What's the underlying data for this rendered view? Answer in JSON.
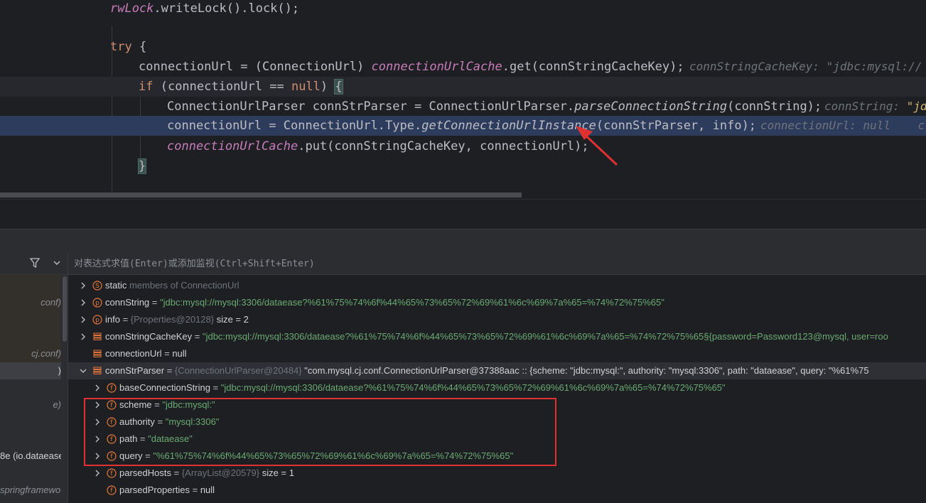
{
  "editor": {
    "lines": [
      {
        "id": "l1",
        "tokens": [
          {
            "t": "rwLock",
            "c": "fld"
          },
          {
            "t": ".writeLock().lock();",
            "c": ""
          }
        ]
      },
      {
        "id": "l2",
        "tokens": []
      },
      {
        "id": "l3",
        "tokens": [
          {
            "t": "try",
            "c": "kw"
          },
          {
            "t": " {",
            "c": ""
          }
        ]
      },
      {
        "id": "l4",
        "tokens": [
          {
            "t": "connectionUrl = (ConnectionUrl) ",
            "c": ""
          },
          {
            "t": "connectionUrlCache",
            "c": "fld"
          },
          {
            "t": ".get(connStringCacheKey);",
            "c": ""
          }
        ],
        "hint": "connStringCacheKey: \"jdbc:mysql://"
      },
      {
        "id": "l5",
        "tokens": [
          {
            "t": "if",
            "c": "kw"
          },
          {
            "t": " (connectionUrl == ",
            "c": ""
          },
          {
            "t": "null",
            "c": "kw"
          },
          {
            "t": ") ",
            "c": ""
          },
          {
            "t": "{",
            "c": "brace"
          }
        ]
      },
      {
        "id": "l6",
        "tokens": [
          {
            "t": "ConnectionUrlParser connStrParser = ConnectionUrlParser.",
            "c": ""
          },
          {
            "t": "parseConnectionString",
            "c": "mth"
          },
          {
            "t": "(connString);",
            "c": ""
          }
        ],
        "hint": "connString: ",
        "hintval": "\"jd"
      },
      {
        "id": "l7",
        "tokens": [
          {
            "t": "connectionUrl = ConnectionUrl.Type.",
            "c": ""
          },
          {
            "t": "getConnectionUrlInstance",
            "c": "mth"
          },
          {
            "t": "(connStrParser, info);",
            "c": ""
          }
        ],
        "hint": "connectionUrl: null    c"
      },
      {
        "id": "l8",
        "tokens": [
          {
            "t": "connectionUrlCache",
            "c": "fld"
          },
          {
            "t": ".put(connStringCacheKey, connectionUrl);",
            "c": ""
          }
        ]
      },
      {
        "id": "l9",
        "tokens": [
          {
            "t": "}",
            "c": "brace"
          }
        ]
      }
    ]
  },
  "frames": {
    "items": [
      "conf)",
      "cj.conf)",
      ")",
      "e)",
      "8e (io.dataease",
      "springframewo"
    ]
  },
  "evaluate": {
    "placeholder": "对表达式求值(Enter)或添加监视(Ctrl+Shift+Enter)"
  },
  "variables": [
    {
      "icon": "S",
      "name": "static",
      "rest": " members of ConnectionUrl",
      "kind": "static"
    },
    {
      "icon": "p",
      "name": "connString",
      "value": "\"jdbc:mysql://mysql:3306/dataease?%61%75%74%6f%44%65%73%65%72%69%61%6c%69%7a%65=%74%72%75%65\""
    },
    {
      "icon": "p",
      "name": "info",
      "ref": "{Properties@20128}",
      "extra": "size = 2"
    },
    {
      "icon": "var",
      "name": "connStringCacheKey",
      "value": "\"jdbc:mysql://mysql:3306/dataease?%61%75%74%6f%44%65%73%65%72%69%61%6c%69%7a%65=%74%72%75%65§{password=Password123@mysql, user=roo"
    },
    {
      "icon": "var",
      "name": "connectionUrl",
      "plain": "null"
    },
    {
      "icon": "var",
      "name": "connStrParser",
      "ref": "{ConnectionUrlParser@20484}",
      "extra": "\"com.mysql.cj.conf.ConnectionUrlParser@37388aac :: {scheme: \"jdbc:mysql:\", authority: \"mysql:3306\", path: \"dataease\", query: \"%61%75"
    },
    {
      "icon": "f",
      "name": "baseConnectionString",
      "value": "\"jdbc:mysql://mysql:3306/dataease?%61%75%74%6f%44%65%73%65%72%69%61%6c%69%7a%65=%74%72%75%65\""
    },
    {
      "icon": "f",
      "name": "scheme",
      "value": "\"jdbc:mysql:\""
    },
    {
      "icon": "f",
      "name": "authority",
      "value": "\"mysql:3306\""
    },
    {
      "icon": "f",
      "name": "path",
      "value": "\"dataease\""
    },
    {
      "icon": "f",
      "name": "query",
      "value": "\"%61%75%74%6f%44%65%73%65%72%69%61%6c%69%7a%65=%74%72%75%65\""
    },
    {
      "icon": "f",
      "name": "parsedHosts",
      "ref": "{ArrayList@20579}",
      "extra": "size = 1"
    },
    {
      "icon": "f",
      "name": "parsedProperties",
      "plain": "null"
    }
  ],
  "colors": {
    "keyword": "#cf8e6d",
    "field": "#c77dbb",
    "string": "#6aab73",
    "exec_line": "#2d3b5c",
    "highlight_box": "#e03131",
    "icon_orange": "#e8793a"
  }
}
